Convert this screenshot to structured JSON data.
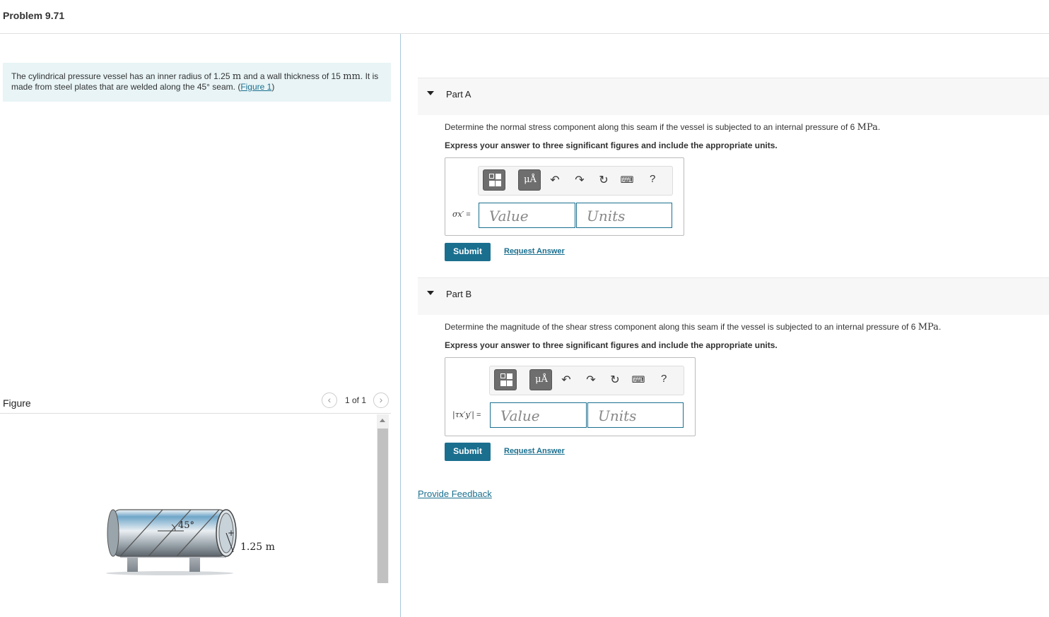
{
  "header": {
    "title": "Problem 9.71"
  },
  "problem": {
    "text_1": "The cylindrical pressure vessel has an inner radius of 1.25 ",
    "unit_m": "m",
    "text_2": " and a wall thickness of 15 ",
    "unit_mm": "mm",
    "text_3": ". It is made from steel plates that are welded along the 45° seam. (",
    "figure_link": "Figure 1",
    "text_4": ")"
  },
  "figure": {
    "label": "Figure",
    "pager": "1 of 1",
    "angle_label": "45°",
    "radius_label": "1.25 m"
  },
  "parts": [
    {
      "name": "Part A",
      "question_pre": "Determine the normal stress component along this seam if the vessel is subjected to an internal pressure of 6 ",
      "question_unit": "MPa",
      "question_post": ".",
      "instruction": "Express your answer to three significant figures and include the appropriate units.",
      "var_symbol": "σx′",
      "var_eq": " =",
      "value_placeholder": "Value",
      "units_placeholder": "Units",
      "submit": "Submit",
      "request": "Request Answer"
    },
    {
      "name": "Part B",
      "question_pre": "Determine the magnitude of the shear stress component along this seam if the vessel is subjected to an internal pressure of 6 ",
      "question_unit": "MPa",
      "question_post": ".",
      "instruction": "Express your answer to three significant figures and include the appropriate units.",
      "var_symbol": "|τx′y′|",
      "var_eq": " =",
      "value_placeholder": "Value",
      "units_placeholder": "Units",
      "submit": "Submit",
      "request": "Request Answer"
    }
  ],
  "toolbar": {
    "mu_label": "μÅ",
    "help_label": "?"
  },
  "feedback": {
    "label": "Provide Feedback"
  }
}
